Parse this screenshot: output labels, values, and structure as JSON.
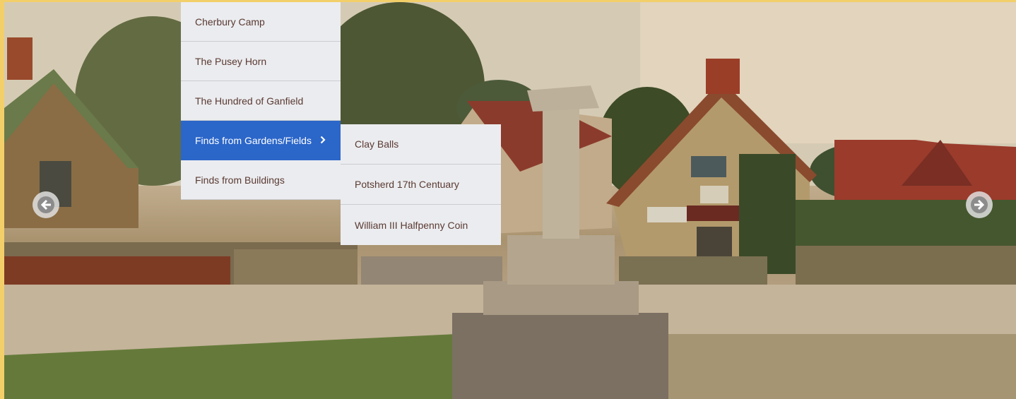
{
  "slider": {
    "image_alt": "Hand-coloured postcard of a village cross with cottages",
    "prev_icon": "arrow-left-circle-icon",
    "next_icon": "arrow-right-circle-icon"
  },
  "menu": {
    "items": [
      {
        "label": "Cherbury Camp"
      },
      {
        "label": "The Pusey Horn"
      },
      {
        "label": "The Hundred of Ganfield"
      },
      {
        "label": "Finds from Gardens/Fields",
        "active": true,
        "icon": "chevron-right-icon"
      },
      {
        "label": "Finds from Buildings"
      }
    ],
    "submenu": [
      {
        "label": "Clay Balls"
      },
      {
        "label": "Potsherd 17th Centuary"
      },
      {
        "label": "William III Halfpenny Coin"
      }
    ]
  },
  "colors": {
    "page_border": "#f3cf6a",
    "menu_bg": "#ebecef",
    "menu_active_bg": "#2b66c9",
    "menu_text": "#5a3a33"
  }
}
